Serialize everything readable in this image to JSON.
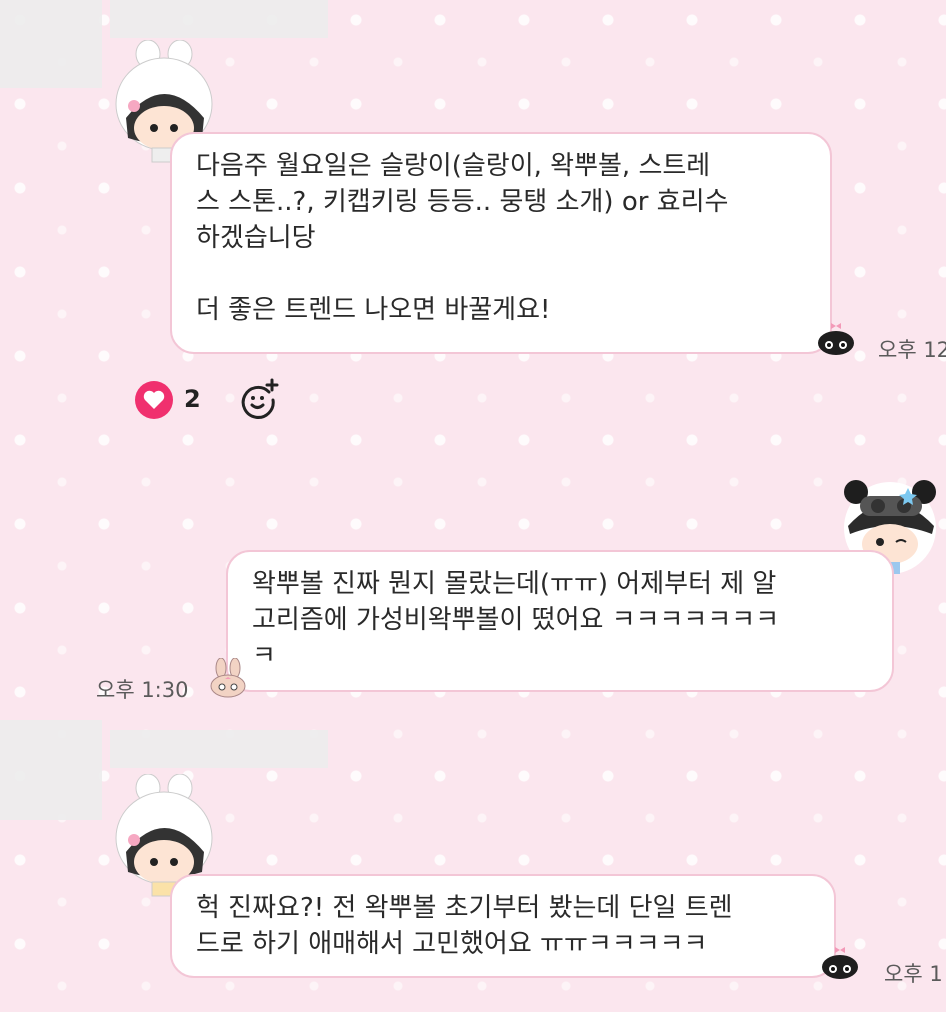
{
  "messages": [
    {
      "sender": "other",
      "text": "다음주 월요일은 슬랑이(슬랑이, 왁뿌볼, 스트레\n스 스톤..?, 키캡키링 등등.. 뭉탱 소개) or 효리수\n하겠습니당\n\n더 좋은 트렌드 나오면 바꿀게요!",
      "time": "오후 12"
    },
    {
      "sender": "me",
      "text": "왁뿌볼 진짜 뭔지 몰랐는데(ㅠㅠ) 어제부터 제 알\n고리즘에 가성비왁뿌볼이 떴어요  ㅋㅋㅋㅋㅋㅋㅋ\nㅋ",
      "time": "오후 1:30"
    },
    {
      "sender": "other",
      "text": "헉 진짜요?! 전 왁뿌볼 초기부터 봤는데 단일 트렌\n드로 하기 애매해서 고민했어요 ㅠㅠㅋㅋㅋㅋㅋ",
      "time": "오후 1"
    }
  ],
  "reactions": {
    "heart_count": "2",
    "heart_icon": "heart-icon",
    "add_icon": "add-reaction-icon"
  },
  "colors": {
    "background": "#fbe6ee",
    "bubble_border": "#f3c6d6",
    "heart": "#f0306e"
  }
}
